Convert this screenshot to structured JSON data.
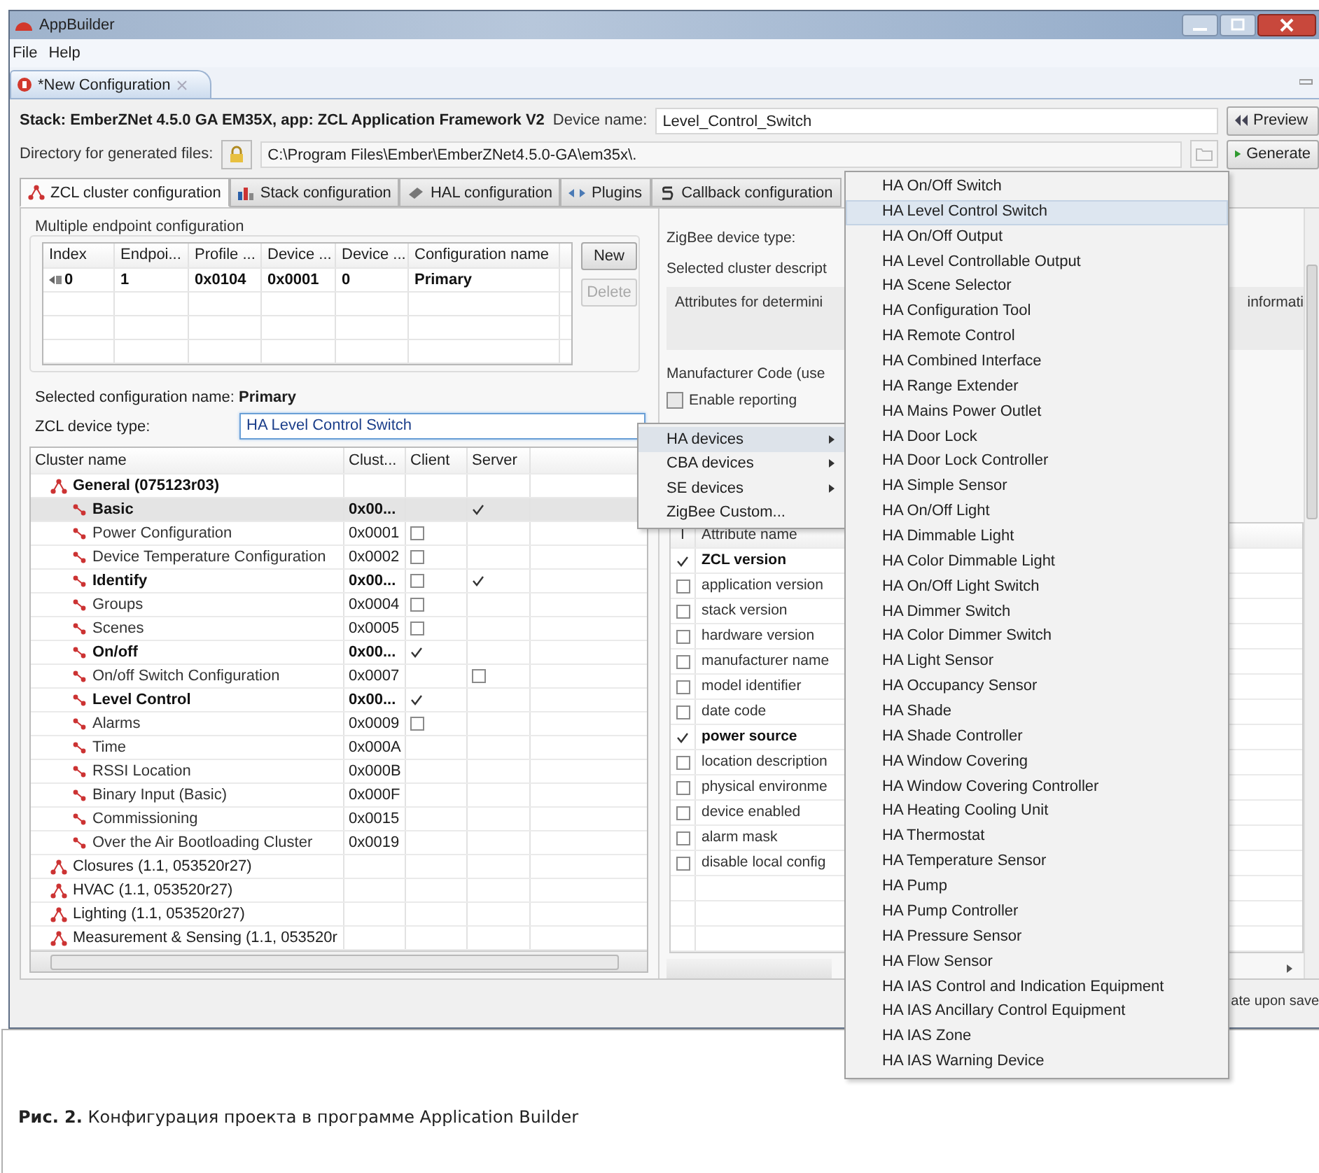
{
  "window": {
    "title": "AppBuilder"
  },
  "menu": [
    "File",
    "Help"
  ],
  "editor_tab": {
    "label": "*New Configuration"
  },
  "stack_label": "Stack: EmberZNet 4.5.0 GA EM35X, app: ZCL Application Framework V2",
  "device_name": {
    "label": "Device name:",
    "value": "Level_Control_Switch"
  },
  "preview_button": "Preview",
  "directory": {
    "label": "Directory for generated files:",
    "value": "C:\\Program Files\\Ember\\EmberZNet4.5.0-GA\\em35x\\."
  },
  "generate_button": "Generate",
  "tabs": [
    {
      "label": "ZCL cluster configuration",
      "selected": true
    },
    {
      "label": "Stack configuration",
      "selected": false
    },
    {
      "label": "HAL configuration",
      "selected": false
    },
    {
      "label": "Plugins",
      "selected": false
    },
    {
      "label": "Callback configuration",
      "selected": false
    }
  ],
  "endpoints": {
    "title": "Multiple endpoint configuration",
    "columns": [
      "Index",
      "Endpoi...",
      "Profile ...",
      "Device ...",
      "Device ...",
      "Configuration name"
    ],
    "rows": [
      {
        "cells": [
          "0",
          "1",
          "0x0104",
          "0x0001",
          "0",
          "Primary"
        ]
      }
    ],
    "buttons": [
      {
        "label": "New",
        "disabled": false
      },
      {
        "label": "Delete",
        "disabled": true
      }
    ]
  },
  "selected_config": "Selected configuration name: **Primary**",
  "device_type": {
    "label": "ZCL device type:",
    "value": "HA Level Control Switch"
  },
  "clusters": {
    "columns": [
      "Cluster name",
      "Clust...",
      "Client",
      "Server"
    ],
    "groups": [
      {
        "name": "General  (075123r03)",
        "enabled": true,
        "children": [
          {
            "name": "Basic",
            "code": "0x00...",
            "enabled": true,
            "selected": true,
            "server_checked": true
          },
          {
            "name": "Power Configuration",
            "code": "0x0001",
            "enabled": false,
            "selected": false,
            "client_checked": false
          },
          {
            "name": "Device Temperature Configuration",
            "code": "0x0002",
            "enabled": false,
            "selected": false,
            "client_checked": false
          },
          {
            "name": "Identify",
            "code": "0x00...",
            "enabled": true,
            "selected": false,
            "client_checked": false,
            "server_checked": true
          },
          {
            "name": "Groups",
            "code": "0x0004",
            "enabled": false,
            "selected": false,
            "client_checked": false
          },
          {
            "name": "Scenes",
            "code": "0x0005",
            "enabled": false,
            "selected": false,
            "client_checked": false
          },
          {
            "name": "On/off",
            "code": "0x00...",
            "enabled": true,
            "selected": false,
            "client_checked": true
          },
          {
            "name": "On/off Switch Configuration",
            "code": "0x0007",
            "enabled": false,
            "selected": false,
            "server_checked": false
          },
          {
            "name": "Level Control",
            "code": "0x00...",
            "enabled": true,
            "selected": false,
            "client_checked": true
          },
          {
            "name": "Alarms",
            "code": "0x0009",
            "enabled": false,
            "selected": false,
            "client_checked": false
          },
          {
            "name": "Time",
            "code": "0x000A",
            "enabled": false,
            "selected": false
          },
          {
            "name": "RSSI Location",
            "code": "0x000B",
            "enabled": false,
            "selected": false
          },
          {
            "name": "Binary Input (Basic)",
            "code": "0x000F",
            "enabled": false,
            "selected": false
          },
          {
            "name": "Commissioning",
            "code": "0x0015",
            "enabled": false,
            "selected": false
          },
          {
            "name": "Over the Air Bootloading Cluster",
            "code": "0x0019",
            "enabled": false,
            "selected": false
          }
        ]
      },
      {
        "name": "Closures  (1.1, 053520r27)",
        "enabled": false
      },
      {
        "name": "HVAC  (1.1, 053520r27)",
        "enabled": false
      },
      {
        "name": "Lighting  (1.1, 053520r27)",
        "enabled": false
      },
      {
        "name": "Measurement & Sensing  (1.1, 053520r",
        "enabled": false
      }
    ]
  },
  "right": {
    "zigbee_label": "ZigBee device type:",
    "description_label": "Selected cluster descript",
    "description": "Attributes for determini",
    "description_tail": "informati",
    "manufacturer_label": "Manufacturer Code (use",
    "reporting": {
      "label": "Enable reporting",
      "checked": false
    }
  },
  "attributes": {
    "columns": [
      "I",
      "Attribute name"
    ],
    "rows": [
      {
        "name": "ZCL version",
        "checked": true
      },
      {
        "name": "application version",
        "checked": false
      },
      {
        "name": "stack version",
        "checked": false
      },
      {
        "name": "hardware version",
        "checked": false
      },
      {
        "name": "manufacturer name",
        "checked": false
      },
      {
        "name": "model identifier",
        "checked": false
      },
      {
        "name": "date code",
        "checked": false
      },
      {
        "name": "power source",
        "checked": true
      },
      {
        "name": "location description",
        "checked": false
      },
      {
        "name": "physical environme",
        "checked": false
      },
      {
        "name": "device enabled",
        "checked": false
      },
      {
        "name": "alarm mask",
        "checked": false
      },
      {
        "name": "disable local config",
        "checked": false
      }
    ]
  },
  "status_text": "ate upon save",
  "context_menu": [
    {
      "label": "HA devices",
      "submenu": true,
      "selected": true
    },
    {
      "label": "CBA devices",
      "submenu": true,
      "selected": false
    },
    {
      "label": "SE devices",
      "submenu": true,
      "selected": false
    },
    {
      "label": "ZigBee Custom...",
      "submenu": false,
      "selected": false
    }
  ],
  "submenu": [
    {
      "label": "HA On/Off Switch",
      "selected": false
    },
    {
      "label": "HA Level Control Switch",
      "selected": true
    },
    {
      "label": "HA On/Off Output",
      "selected": false
    },
    {
      "label": "HA Level Controllable Output",
      "selected": false
    },
    {
      "label": "HA Scene Selector",
      "selected": false
    },
    {
      "label": "HA Configuration Tool",
      "selected": false
    },
    {
      "label": "HA Remote Control",
      "selected": false
    },
    {
      "label": "HA Combined Interface",
      "selected": false
    },
    {
      "label": "HA Range Extender",
      "selected": false
    },
    {
      "label": "HA Mains Power Outlet",
      "selected": false
    },
    {
      "label": "HA Door Lock",
      "selected": false
    },
    {
      "label": "HA Door Lock Controller",
      "selected": false
    },
    {
      "label": "HA Simple Sensor",
      "selected": false
    },
    {
      "label": "HA On/Off Light",
      "selected": false
    },
    {
      "label": "HA Dimmable Light",
      "selected": false
    },
    {
      "label": "HA Color Dimmable Light",
      "selected": false
    },
    {
      "label": "HA On/Off Light Switch",
      "selected": false
    },
    {
      "label": "HA Dimmer Switch",
      "selected": false
    },
    {
      "label": "HA Color Dimmer Switch",
      "selected": false
    },
    {
      "label": "HA Light Sensor",
      "selected": false
    },
    {
      "label": "HA Occupancy Sensor",
      "selected": false
    },
    {
      "label": "HA Shade",
      "selected": false
    },
    {
      "label": "HA Shade Controller",
      "selected": false
    },
    {
      "label": "HA Window Covering",
      "selected": false
    },
    {
      "label": "HA Window Covering Controller",
      "selected": false
    },
    {
      "label": "HA Heating Cooling Unit",
      "selected": false
    },
    {
      "label": "HA Thermostat",
      "selected": false
    },
    {
      "label": "HA Temperature Sensor",
      "selected": false
    },
    {
      "label": "HA Pump",
      "selected": false
    },
    {
      "label": "HA Pump Controller",
      "selected": false
    },
    {
      "label": "HA Pressure Sensor",
      "selected": false
    },
    {
      "label": "HA Flow Sensor",
      "selected": false
    },
    {
      "label": "HA IAS Control and Indication Equipment",
      "selected": false
    },
    {
      "label": "HA IAS Ancillary Control Equipment",
      "selected": false
    },
    {
      "label": "HA IAS Zone",
      "selected": false
    },
    {
      "label": "HA IAS Warning Device",
      "selected": false
    }
  ],
  "caption": "**Рис. 2.** Конфигурация проекта в программе Application Builder"
}
